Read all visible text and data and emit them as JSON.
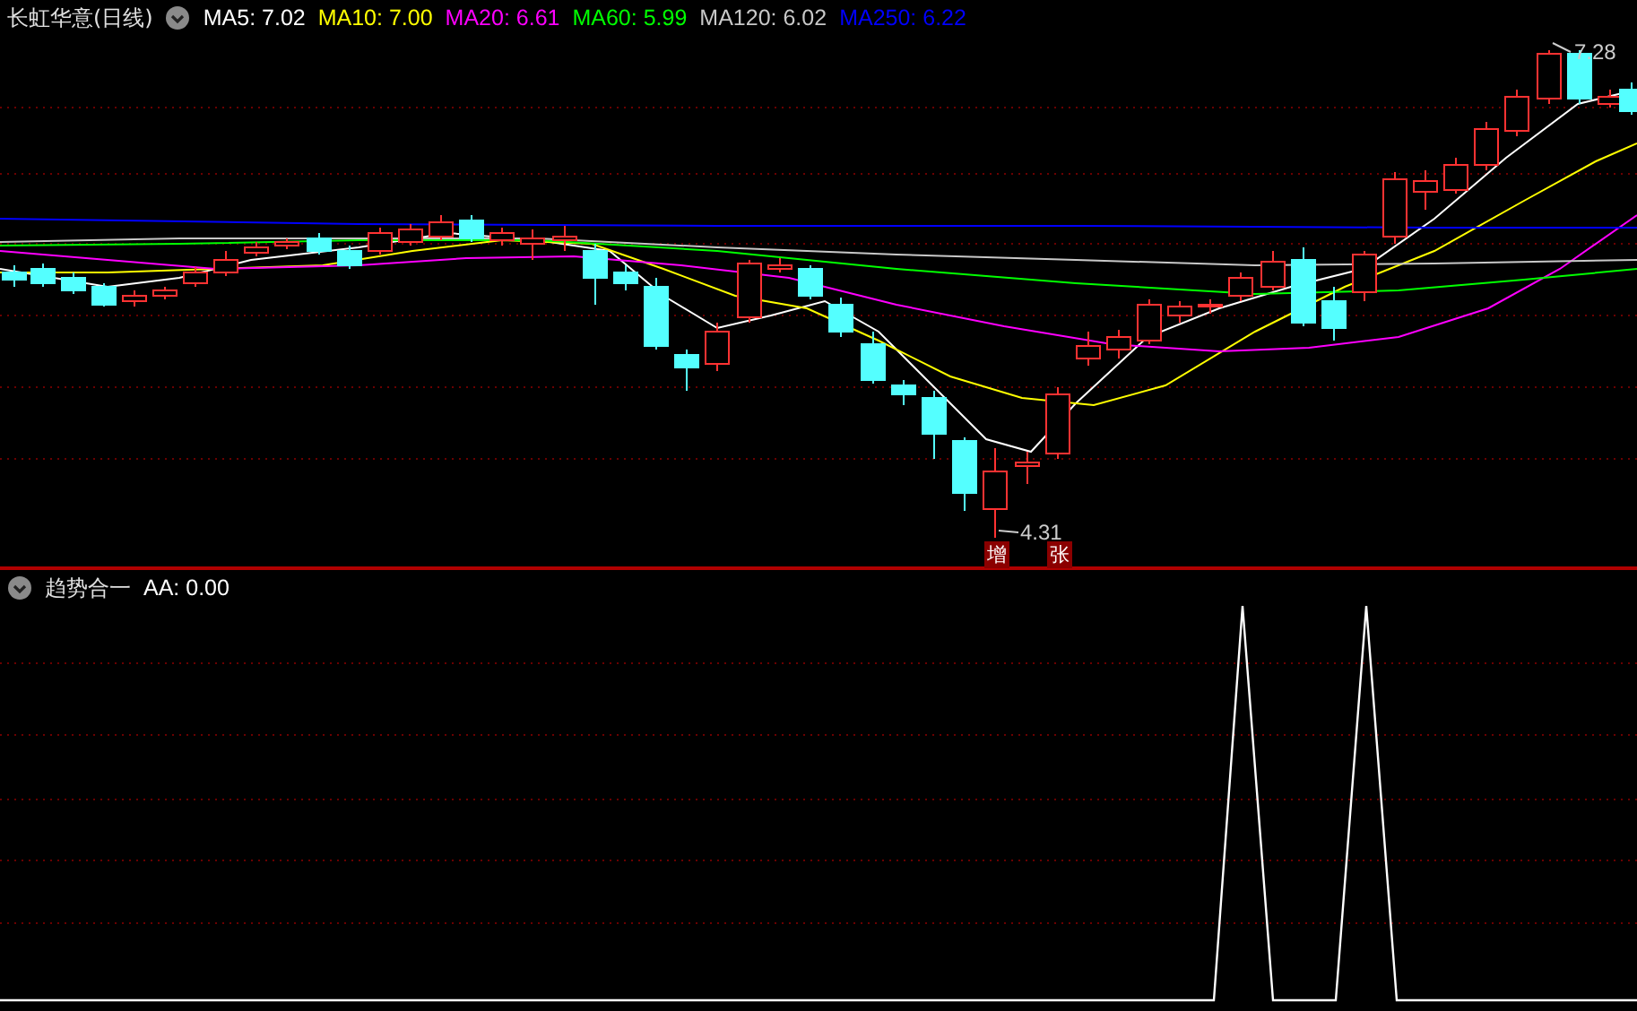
{
  "main_panel": {
    "title": "长虹华意(日线)",
    "indicators": [
      {
        "label": "MA5: 7.02",
        "color": "#ffffff"
      },
      {
        "label": "MA10: 7.00",
        "color": "#ffff00"
      },
      {
        "label": "MA20: 6.61",
        "color": "#ff00ff"
      },
      {
        "label": "MA60: 5.99",
        "color": "#00ff00"
      },
      {
        "label": "MA120: 6.02",
        "color": "#c8c8c8"
      },
      {
        "label": "MA250: 6.22",
        "color": "#0000ff"
      }
    ],
    "high_label": "7.28",
    "low_label": "4.31",
    "signals": [
      "增",
      "张"
    ]
  },
  "sub_panel": {
    "title": "趋势合一",
    "reading": "AA: 0.00"
  }
}
